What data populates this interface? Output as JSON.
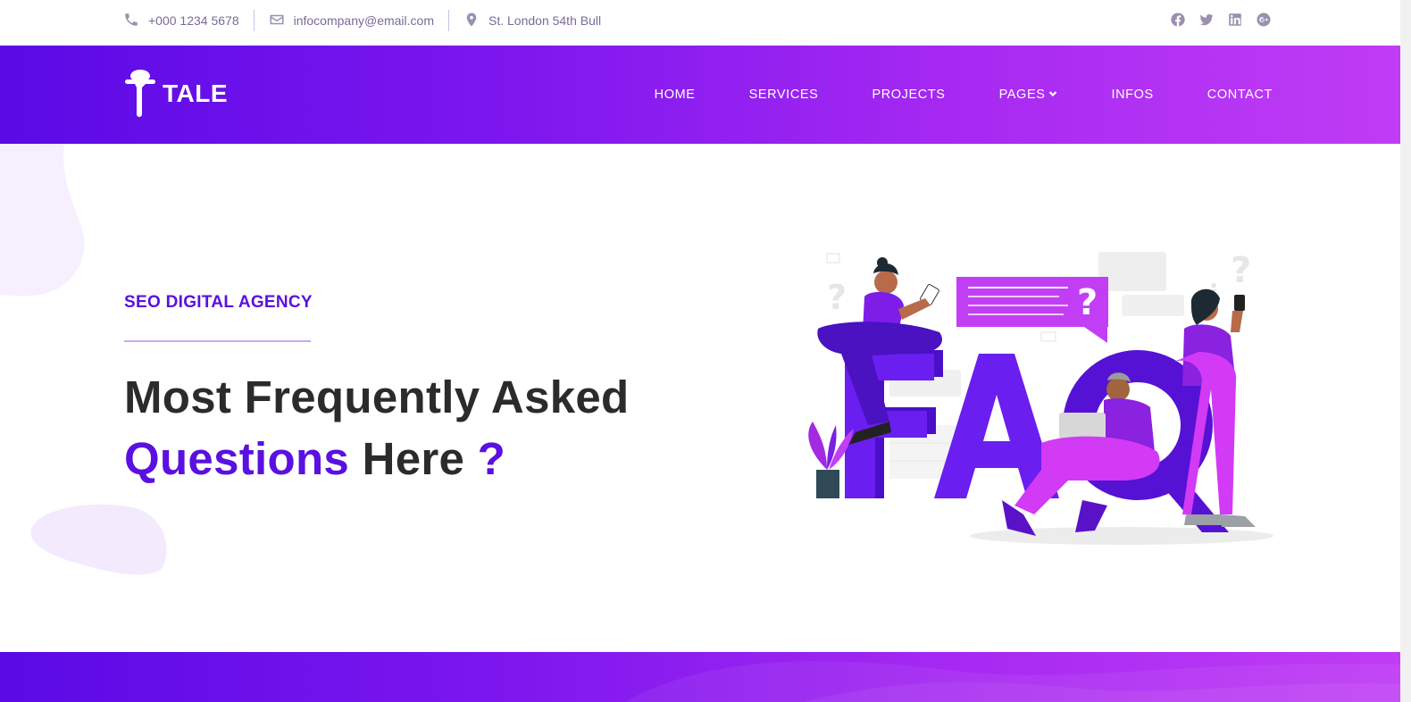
{
  "topbar": {
    "phone": "+000 1234 5678",
    "email": "infocompany@email.com",
    "address": "St. London 54th Bull",
    "social": [
      "facebook-icon",
      "twitter-icon",
      "linkedin-icon",
      "google-plus-icon"
    ]
  },
  "brand": {
    "name": "TALE"
  },
  "nav": {
    "items": [
      {
        "label": "HOME"
      },
      {
        "label": "SERVICES"
      },
      {
        "label": "PROJECTS"
      },
      {
        "label": "PAGES"
      },
      {
        "label": "INFOS"
      },
      {
        "label": "CONTACT"
      }
    ]
  },
  "hero": {
    "eyebrow": "SEO DIGITAL AGENCY",
    "title_line1": "Most Frequently Asked",
    "title_accent": "Questions",
    "title_rest": "Here",
    "title_mark": "?"
  },
  "colors": {
    "accent": "#5a10e0",
    "gradient_start": "#5a0ae6",
    "gradient_end": "#c03cf5",
    "heading": "#2b2b2b"
  }
}
